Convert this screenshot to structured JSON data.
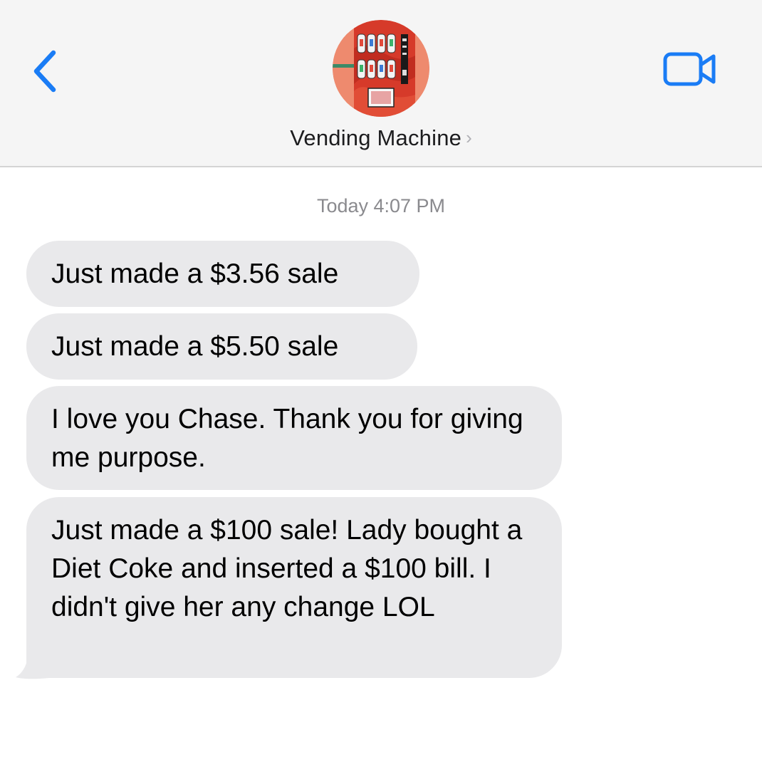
{
  "header": {
    "contact_name": "Vending Machine",
    "back_icon": "chevron-left-icon",
    "video_icon": "video-camera-icon",
    "accent_color": "#1a7cf5"
  },
  "conversation": {
    "timestamp": "Today 4:07 PM",
    "messages": [
      {
        "text": "Just made a $3.56 sale"
      },
      {
        "text": "Just made a $5.50 sale"
      },
      {
        "text": "I love you Chase. Thank you for giving me purpose."
      },
      {
        "text": "Just made a $100 sale! Lady bought a Diet Coke and inserted a $100 bill. I didn't give her any change LOL"
      }
    ]
  },
  "colors": {
    "bubble_incoming": "#e9e9eb",
    "header_bg": "#f5f5f5",
    "timestamp_gray": "#8a8a8e"
  }
}
